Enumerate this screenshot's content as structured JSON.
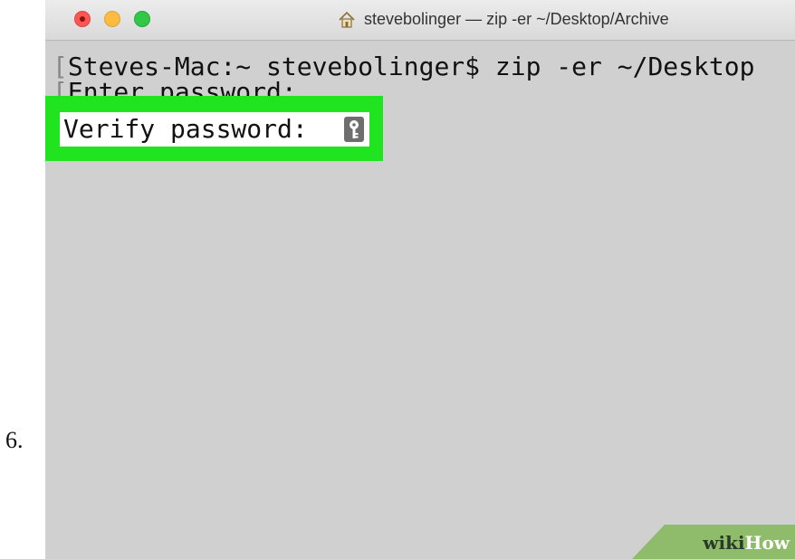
{
  "step": {
    "number": "6."
  },
  "window": {
    "title": "stevebolinger — zip -er ~/Desktop/Archive",
    "title_icon": "home-icon",
    "traffic_lights": {
      "close_color": "#fc5753",
      "minimize_color": "#fdbc40",
      "zoom_color": "#33c748"
    }
  },
  "terminal": {
    "lines": [
      "Steves-Mac:~ stevebolinger$ zip -er ~/Desktop",
      "Enter password:"
    ],
    "verify_prompt": "Verify password:",
    "cursor_icon": "key-icon",
    "background_color": "#d0d0d0",
    "highlight_color": "#1fe41f"
  },
  "watermark": {
    "wiki": "wiki",
    "how": "How"
  }
}
